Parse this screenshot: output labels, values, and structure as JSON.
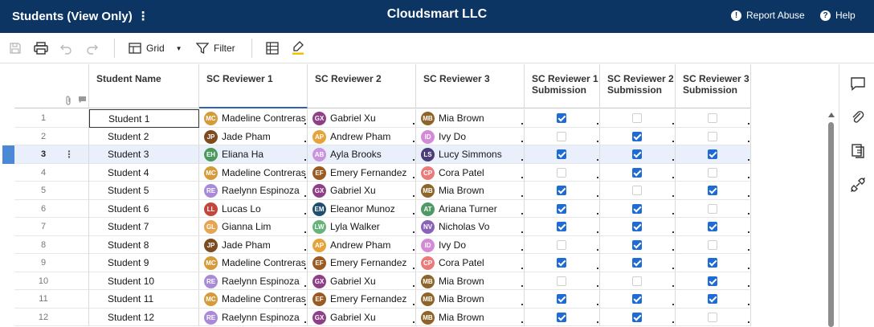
{
  "header": {
    "title": "Students (View Only)",
    "title_menu_glyph": "⋮",
    "org_name": "Cloudsmart LLC",
    "report_abuse": "Report Abuse",
    "help": "Help"
  },
  "toolbar": {
    "view_label": "Grid",
    "filter_label": "Filter"
  },
  "columns": [
    {
      "key": "name",
      "label": "Student Name"
    },
    {
      "key": "r1",
      "label": "SC Reviewer 1"
    },
    {
      "key": "r2",
      "label": "SC Reviewer 2"
    },
    {
      "key": "r3",
      "label": "SC Reviewer 3"
    },
    {
      "key": "s1",
      "label": "SC Reviewer 1 Submission"
    },
    {
      "key": "s2",
      "label": "SC Reviewer 2 Submission"
    },
    {
      "key": "s3",
      "label": "SC Reviewer 3 Submission"
    }
  ],
  "people": {
    "MC": {
      "name": "Madeline Contreras",
      "color": "#d59a3a"
    },
    "GX": {
      "name": "Gabriel Xu",
      "color": "#8e3f88"
    },
    "MB": {
      "name": "Mia Brown",
      "color": "#8e6428"
    },
    "JP": {
      "name": "Jade Pham",
      "color": "#7e4a1f"
    },
    "AP": {
      "name": "Andrew Pham",
      "color": "#e6a33a"
    },
    "ID": {
      "name": "Ivy Do",
      "color": "#d58ad8"
    },
    "EH": {
      "name": "Eliana Ha",
      "color": "#4b9a5c"
    },
    "AB": {
      "name": "Ayla Brooks",
      "color": "#c993dd"
    },
    "LS": {
      "name": "Lucy Simmons",
      "color": "#4a3d7a"
    },
    "EF": {
      "name": "Emery Fernandez",
      "color": "#9a5a22"
    },
    "CP": {
      "name": "Cora Patel",
      "color": "#ea7b7b"
    },
    "RE": {
      "name": "Raelynn Espinoza",
      "color": "#a98ad9"
    },
    "LL": {
      "name": "Lucas Lo",
      "color": "#c4453c"
    },
    "EM": {
      "name": "Eleanor Munoz",
      "color": "#1f4e6f"
    },
    "AT": {
      "name": "Ariana Turner",
      "color": "#4f9a64"
    },
    "GL": {
      "name": "Gianna Lim",
      "color": "#e6a552"
    },
    "LW": {
      "name": "Lyla Walker",
      "color": "#67b37a"
    },
    "NV": {
      "name": "Nicholas Vo",
      "color": "#8a63b8"
    }
  },
  "rows": [
    {
      "num": "1",
      "name": "Student 1",
      "r1": "MC",
      "r2": "GX",
      "r3": "MB",
      "s": [
        true,
        false,
        false
      ]
    },
    {
      "num": "2",
      "name": "Student 2",
      "r1": "JP",
      "r2": "AP",
      "r3": "ID",
      "s": [
        false,
        true,
        false
      ]
    },
    {
      "num": "3",
      "name": "Student 3",
      "r1": "EH",
      "r2": "AB",
      "r3": "LS",
      "s": [
        true,
        true,
        true
      ],
      "selected": true
    },
    {
      "num": "4",
      "name": "Student 4",
      "r1": "MC",
      "r2": "EF",
      "r3": "CP",
      "s": [
        false,
        true,
        false
      ]
    },
    {
      "num": "5",
      "name": "Student 5",
      "r1": "RE",
      "r2": "GX",
      "r3": "MB",
      "s": [
        true,
        false,
        true
      ]
    },
    {
      "num": "6",
      "name": "Student 6",
      "r1": "LL",
      "r2": "EM",
      "r3": "AT",
      "s": [
        true,
        true,
        false
      ]
    },
    {
      "num": "7",
      "name": "Student 7",
      "r1": "GL",
      "r2": "LW",
      "r3": "NV",
      "s": [
        true,
        true,
        true
      ]
    },
    {
      "num": "8",
      "name": "Student 8",
      "r1": "JP",
      "r2": "AP",
      "r3": "ID",
      "s": [
        false,
        true,
        false
      ]
    },
    {
      "num": "9",
      "name": "Student 9",
      "r1": "MC",
      "r2": "EF",
      "r3": "CP",
      "s": [
        true,
        true,
        true
      ]
    },
    {
      "num": "10",
      "name": "Student 10",
      "r1": "RE",
      "r2": "GX",
      "r3": "MB",
      "s": [
        false,
        false,
        true
      ]
    },
    {
      "num": "11",
      "name": "Student 11",
      "r1": "MC",
      "r2": "EF",
      "r3": "MB",
      "s": [
        true,
        true,
        true
      ]
    },
    {
      "num": "12",
      "name": "Student 12",
      "r1": "RE",
      "r2": "GX",
      "r3": "MB",
      "s": [
        true,
        true,
        false
      ]
    }
  ]
}
